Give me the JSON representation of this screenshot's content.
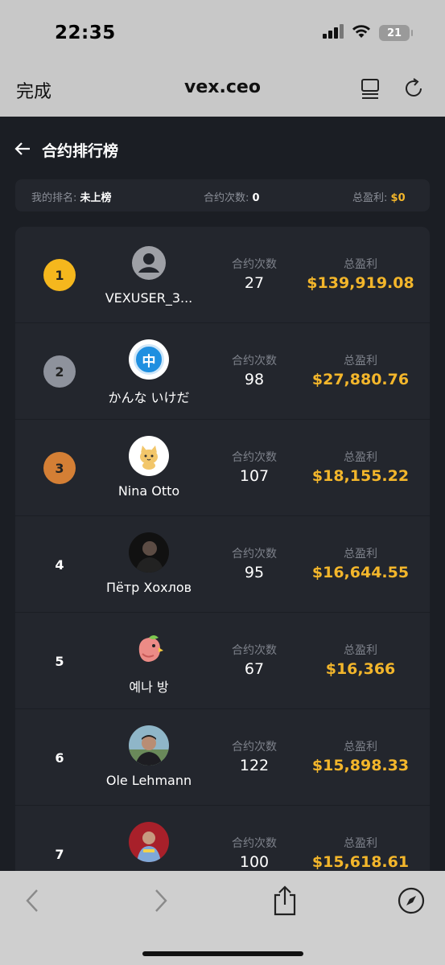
{
  "status": {
    "time": "22:35",
    "battery": "21"
  },
  "safari": {
    "done": "完成",
    "url": "vex.ceo"
  },
  "page": {
    "title": "合约排行榜"
  },
  "summary": {
    "rank_label": "我的排名:",
    "rank_value": "未上榜",
    "count_label": "合约次数:",
    "count_value": "0",
    "profit_label": "总盈利:",
    "profit_value": "$0"
  },
  "columns": {
    "count": "合约次数",
    "profit": "总盈利"
  },
  "leaderboard": [
    {
      "rank": "1",
      "name": "VEXUSER_3...",
      "count": "27",
      "profit": "$139,919.08",
      "avatar": "default-user-icon"
    },
    {
      "rank": "2",
      "name": "かんな いけだ",
      "count": "98",
      "profit": "$27,880.76",
      "avatar": "zhong-badge-icon",
      "avatar_glyph": "中"
    },
    {
      "rank": "3",
      "name": "Nina Otto",
      "count": "107",
      "profit": "$18,155.22",
      "avatar": "cat-icon"
    },
    {
      "rank": "4",
      "name": "Пётр Хохлов",
      "count": "95",
      "profit": "$16,644.55",
      "avatar": "photo-avatar"
    },
    {
      "rank": "5",
      "name": "예나 방",
      "count": "67",
      "profit": "$16,366",
      "avatar": "bird-icon"
    },
    {
      "rank": "6",
      "name": "Ole Lehmann",
      "count": "122",
      "profit": "$15,898.33",
      "avatar": "photo-avatar"
    },
    {
      "rank": "7",
      "name": "",
      "count": "100",
      "profit": "$15,618.61",
      "avatar": "photo-avatar"
    }
  ],
  "colors": {
    "gold": "#f3b62b",
    "rank1": "#f5b71d",
    "rank2": "#8e929c",
    "rank3": "#d47f35",
    "card": "#23262d",
    "background": "#1b1e24"
  }
}
